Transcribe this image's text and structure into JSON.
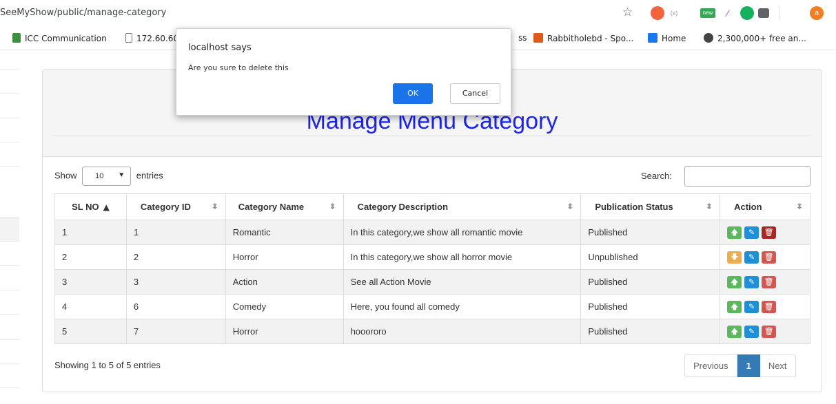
{
  "browser": {
    "url": "SeeMyShow/public/manage-category",
    "bookmarks": [
      {
        "label": "ICC Communication"
      },
      {
        "label": "172.60.60"
      },
      {
        "label": "ss"
      },
      {
        "label": "Rabbitholebd - Spo..."
      },
      {
        "label": "Home"
      },
      {
        "label": "2,300,000+ free an..."
      }
    ],
    "extensions": {
      "new_badge": "new",
      "avatar_letter": "a"
    }
  },
  "dialog": {
    "title": "localhost says",
    "message": "Are you sure to delete this",
    "ok_label": "OK",
    "cancel_label": "Cancel"
  },
  "page": {
    "title": "Manage Menu Category",
    "show_label": "Show",
    "entries_value": "10",
    "entries_label": "entries",
    "search_label": "Search:",
    "columns": [
      "SL NO",
      "Category ID",
      "Category Name",
      "Category Description",
      "Publication Status",
      "Action"
    ],
    "rows": [
      {
        "sl": "1",
        "id": "1",
        "name": "Romantic",
        "desc": "In this category,we show all romantic movie",
        "status": "Published"
      },
      {
        "sl": "2",
        "id": "2",
        "name": "Horror",
        "desc": "In this category,we show all horror movie",
        "status": "Unpublished"
      },
      {
        "sl": "3",
        "id": "3",
        "name": "Action",
        "desc": "See all Action Movie",
        "status": "Published"
      },
      {
        "sl": "4",
        "id": "6",
        "name": "Comedy",
        "desc": "Here, you found all comedy",
        "status": "Published"
      },
      {
        "sl": "5",
        "id": "7",
        "name": "Horror",
        "desc": "hooororo",
        "status": "Published"
      }
    ],
    "info": "Showing 1 to 5 of 5 entries",
    "pagination": {
      "previous": "Previous",
      "current": "1",
      "next": "Next"
    }
  },
  "colors": {
    "title": "#1a22ff",
    "publish_btn": "#5cb85c",
    "unpublish_btn": "#f0ad4e",
    "edit_btn": "#337ab7",
    "delete_btn": "#d9534f",
    "ok_btn": "#1a73e8"
  }
}
